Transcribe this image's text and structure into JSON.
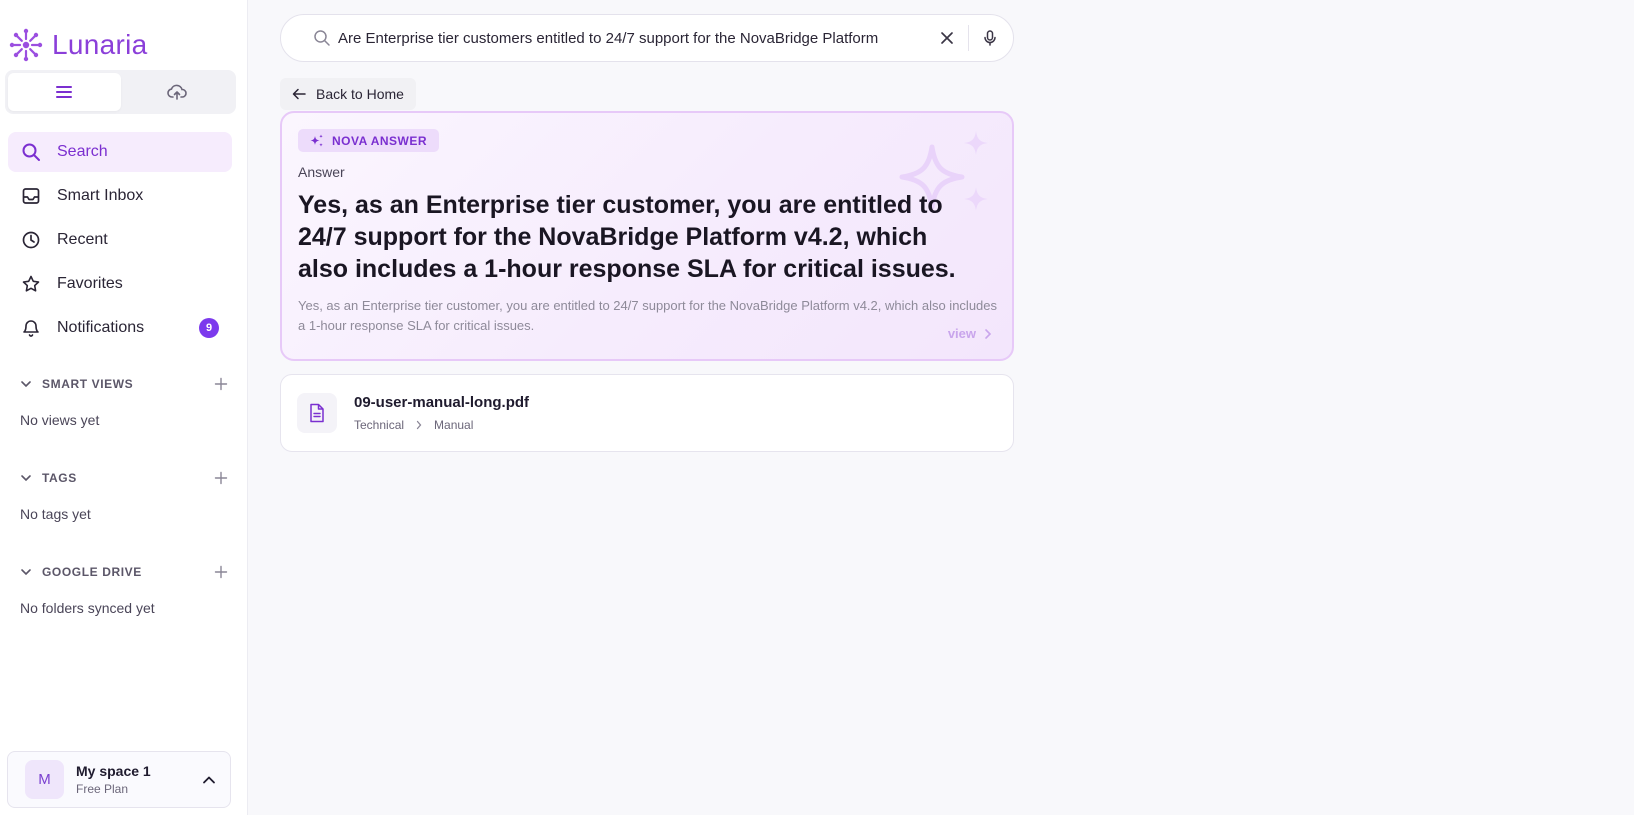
{
  "app": {
    "name": "Lunaria"
  },
  "sidebar": {
    "nav": [
      {
        "label": "Search",
        "icon": "search-icon",
        "active": true
      },
      {
        "label": "Smart Inbox",
        "icon": "inbox-icon"
      },
      {
        "label": "Recent",
        "icon": "clock-icon"
      },
      {
        "label": "Favorites",
        "icon": "star-icon"
      },
      {
        "label": "Notifications",
        "icon": "bell-icon",
        "badge": "9"
      }
    ],
    "sections": [
      {
        "title": "SMART VIEWS",
        "empty": "No views yet"
      },
      {
        "title": "TAGS",
        "empty": "No tags yet"
      },
      {
        "title": "GOOGLE DRIVE",
        "empty": "No folders synced yet"
      }
    ],
    "space": {
      "initial": "M",
      "name": "My space 1",
      "plan": "Free Plan"
    }
  },
  "search": {
    "value": "Are Enterprise tier customers entitled to 24/7 support for the NovaBridge Platform"
  },
  "back_label": "Back to Home",
  "answer": {
    "pill": "NOVA ANSWER",
    "label": "Answer",
    "main": "Yes, as an Enterprise tier customer, you are entitled to 24/7 support for the NovaBridge Platform v4.2, which also includes a 1-hour response SLA for critical issues.",
    "sub": "Yes, as an Enterprise tier customer, you are entitled to 24/7 support for the NovaBridge Platform v4.2, which also includes a 1-hour response SLA for critical issues.",
    "view_label": "view"
  },
  "result": {
    "name": "09-user-manual-long.pdf",
    "path": [
      "Technical",
      "Manual"
    ]
  },
  "colors": {
    "accent": "#8b3fd9",
    "badge": "#7c3aed",
    "active_bg": "#f6ecfd"
  }
}
